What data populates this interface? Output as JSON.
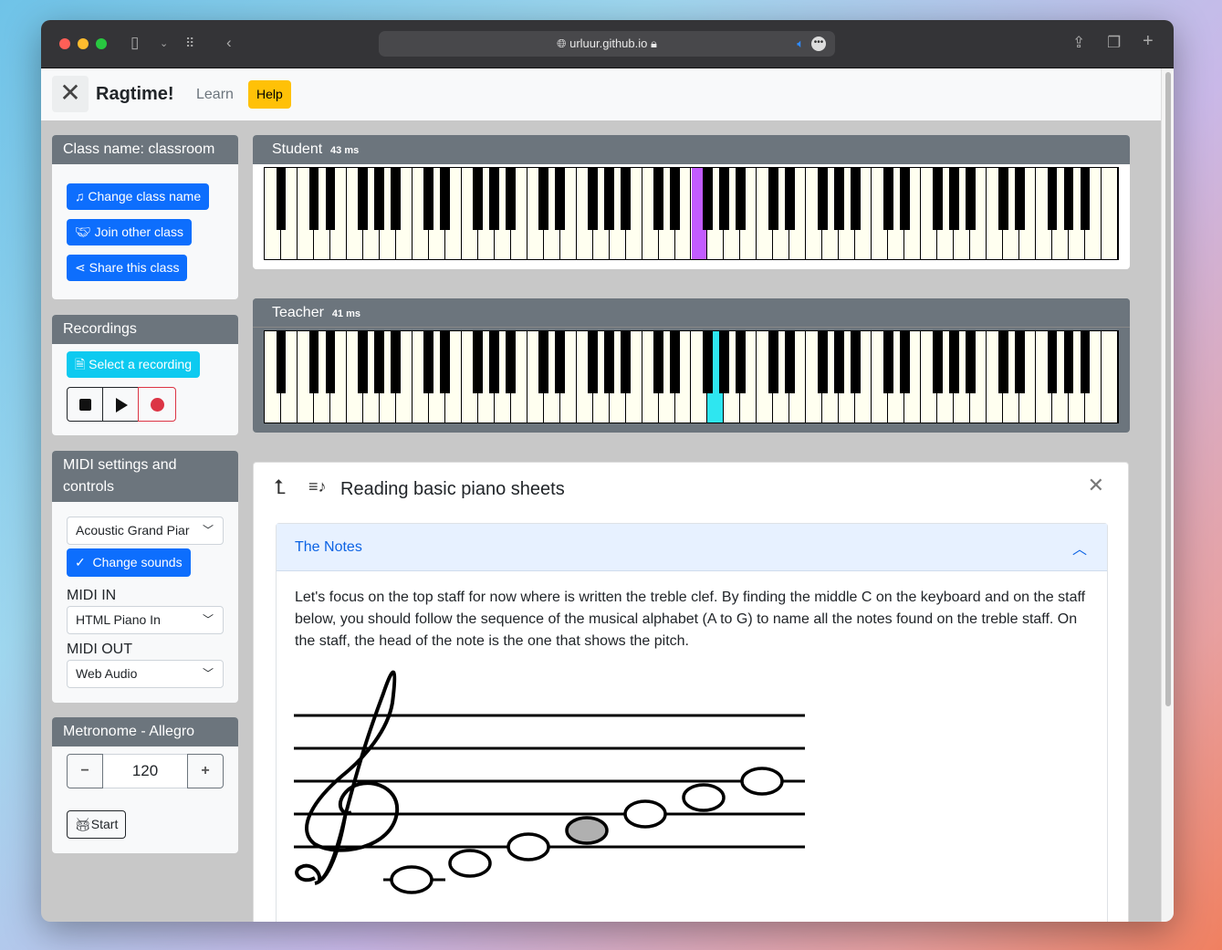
{
  "browser": {
    "url": "urluur.github.io"
  },
  "navbar": {
    "brand": "Ragtime!",
    "learn": "Learn",
    "help": "Help"
  },
  "class_card": {
    "title": "Class name: classroom",
    "buttons": [
      "Change class name",
      "Join other class",
      "Share this class"
    ]
  },
  "recordings": {
    "title": "Recordings",
    "select": "Select a recording"
  },
  "midi": {
    "title_line1": "MIDI settings and",
    "title_line2": "controls",
    "instrument": "Acoustic Grand Piar",
    "change_sounds": "Change sounds",
    "midi_in_label": "MIDI IN",
    "midi_in": "HTML Piano In",
    "midi_out_label": "MIDI OUT",
    "midi_out": "Web Audio"
  },
  "metronome": {
    "title": "Metronome - Allegro",
    "minus": "−",
    "bpm": "120",
    "plus": "+",
    "start": "Start"
  },
  "student": {
    "label": "Student",
    "latency": "43 ms",
    "highlight_white_key": 26,
    "color": "#c25cff"
  },
  "teacher": {
    "label": "Teacher",
    "latency": "41 ms",
    "highlight_white_key": 27,
    "color": "#2ee6f0"
  },
  "lesson": {
    "title": "Reading basic piano sheets",
    "section": "The Notes",
    "text": "Let's focus on the top staff for now where is written the treble clef. By finding the middle C on the keyboard and on the staff below, you should follow the sequence of the musical alphabet (A to G) to name all the notes found on the treble staff. On the staff, the head of the note is the one that shows the pitch.",
    "notes": [
      {
        "name": "C4",
        "filled": false
      },
      {
        "name": "D4",
        "filled": false
      },
      {
        "name": "E4",
        "filled": false
      },
      {
        "name": "F4",
        "filled": true
      },
      {
        "name": "G4",
        "filled": false
      },
      {
        "name": "A4",
        "filled": false
      },
      {
        "name": "B4",
        "filled": false
      }
    ]
  }
}
